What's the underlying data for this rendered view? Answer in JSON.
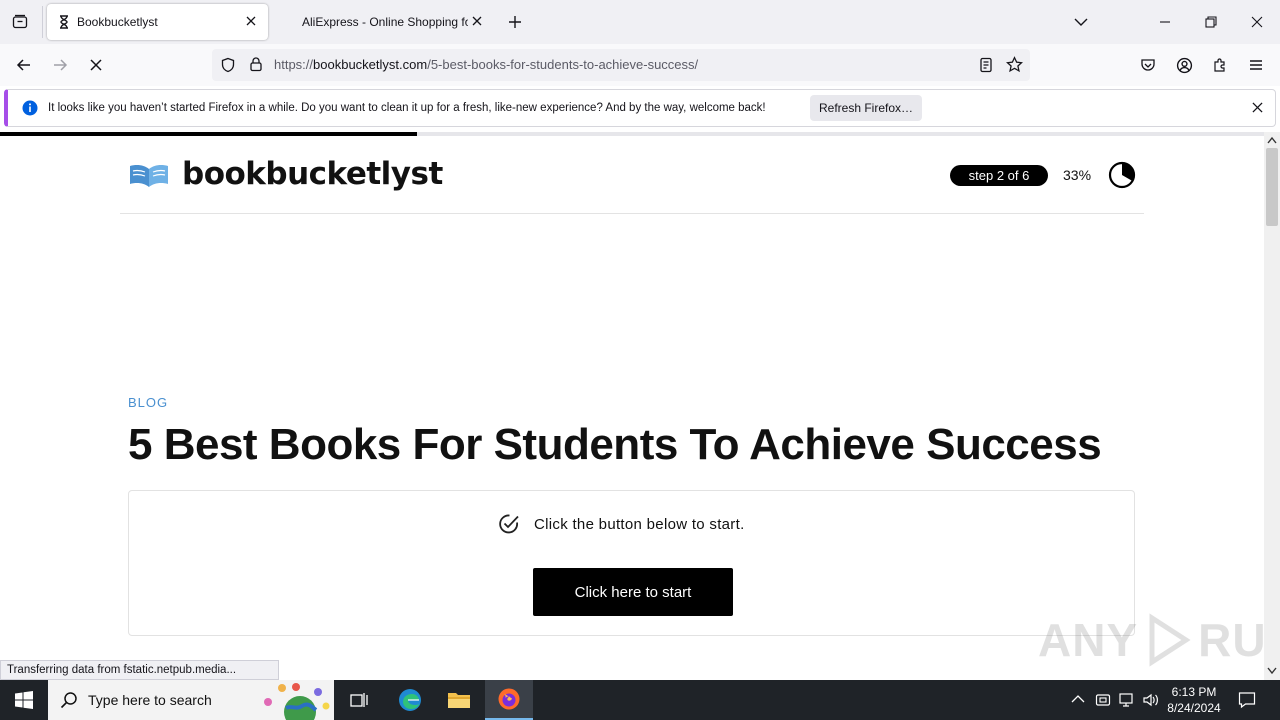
{
  "browser": {
    "tabs": [
      {
        "title": "Bookbucketlyst",
        "active": true
      },
      {
        "title": "AliExpress - Online Shopping fo",
        "active": false
      }
    ],
    "url": {
      "scheme": "https://",
      "host": "bookbucketlyst.com",
      "path": "/5-best-books-for-students-to-achieve-success/"
    },
    "notification": {
      "message": "It looks like you haven’t started Firefox in a while. Do you want to clean it up for a fresh, like-new experience? And by the way, welcome back!",
      "button_label": "Refresh Firefox…"
    },
    "status_text": "Transferring data from fstatic.netpub.media...",
    "load_progress": 0.33
  },
  "site": {
    "logo_text": "bookbucketlyst",
    "step_label": "step 2 of 6",
    "step_percent": "33%",
    "category": "BLOG",
    "article_title": "5 Best Books For Students To Achieve Success",
    "card_message": "Click the button below to start.",
    "start_button": "Click here to start"
  },
  "taskbar": {
    "search_placeholder": "Type here to search",
    "time": "6:13 PM",
    "date": "8/24/2024"
  },
  "colors": {
    "accent_link": "#4a90d0",
    "notification_stripe": "#a64ee8",
    "button_bg": "#000000"
  }
}
